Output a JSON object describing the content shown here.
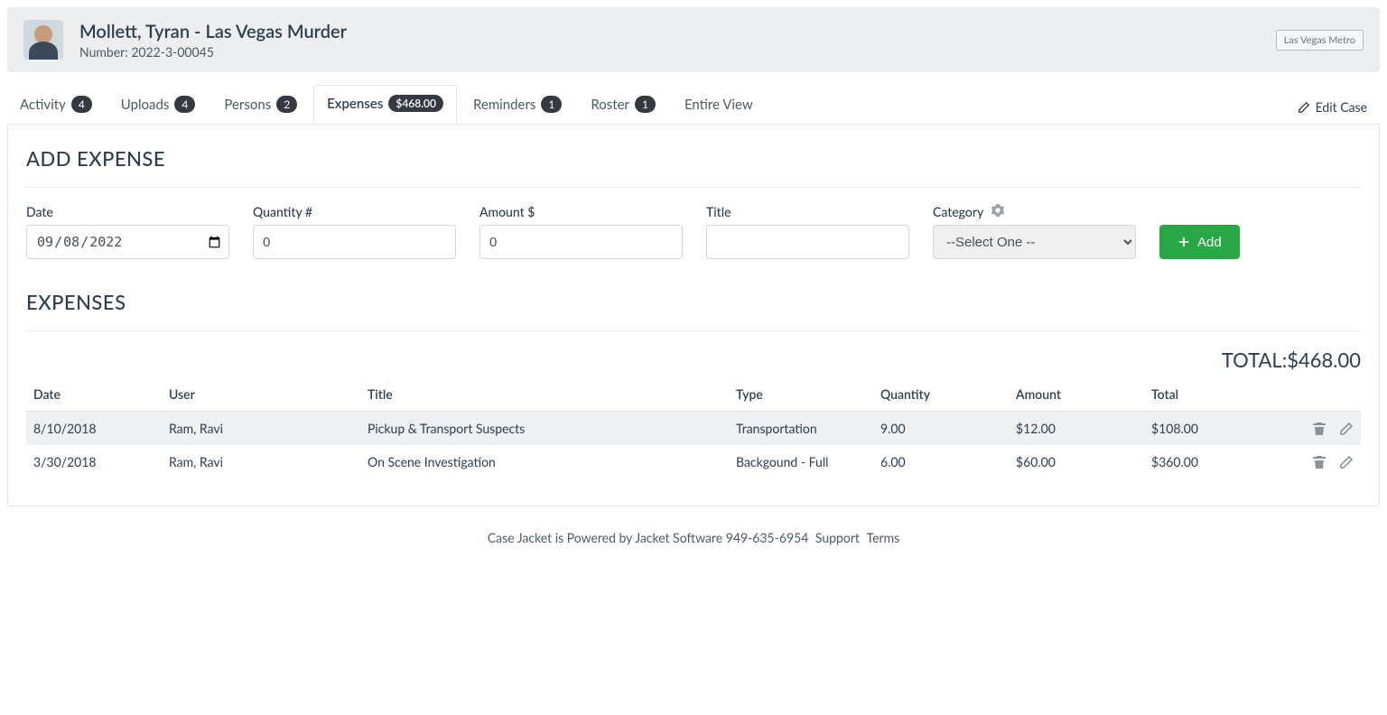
{
  "header": {
    "title": "Mollett, Tyran - Las Vegas Murder",
    "number_label": "Number:",
    "number_value": "2022-3-00045",
    "org_badge": "Las Vegas Metro"
  },
  "tabs": {
    "activity": {
      "label": "Activity",
      "count": "4"
    },
    "uploads": {
      "label": "Uploads",
      "count": "4"
    },
    "persons": {
      "label": "Persons",
      "count": "2"
    },
    "expenses": {
      "label": "Expenses",
      "badge": "$468.00"
    },
    "reminders": {
      "label": "Reminders",
      "count": "1"
    },
    "roster": {
      "label": "Roster",
      "count": "1"
    },
    "entire": {
      "label": "Entire View"
    },
    "edit_case": "Edit Case"
  },
  "add_expense": {
    "heading": "ADD EXPENSE",
    "date_label": "Date",
    "date_value": "2022-09-08",
    "qty_label": "Quantity #",
    "qty_value": "0",
    "amount_label": "Amount $",
    "amount_value": "0",
    "title_label": "Title",
    "title_value": "",
    "category_label": "Category",
    "category_selected": "--Select One --",
    "add_btn": "Add"
  },
  "expenses": {
    "heading": "EXPENSES",
    "total_label": "TOTAL:",
    "total_value": "$468.00",
    "columns": {
      "date": "Date",
      "user": "User",
      "title": "Title",
      "type": "Type",
      "quantity": "Quantity",
      "amount": "Amount",
      "total": "Total"
    },
    "rows": [
      {
        "date": "8/10/2018",
        "user": "Ram, Ravi",
        "title": "Pickup & Transport Suspects",
        "type": "Transportation",
        "quantity": "9.00",
        "amount": "$12.00",
        "total": "$108.00"
      },
      {
        "date": "3/30/2018",
        "user": "Ram, Ravi",
        "title": "On Scene Investigation",
        "type": "Backgound - Full",
        "quantity": "6.00",
        "amount": "$60.00",
        "total": "$360.00"
      }
    ]
  },
  "footer": {
    "prefix": "Case Jacket is Powered by Jacket Software 949-635-6954",
    "support": "Support",
    "terms": "Terms"
  }
}
